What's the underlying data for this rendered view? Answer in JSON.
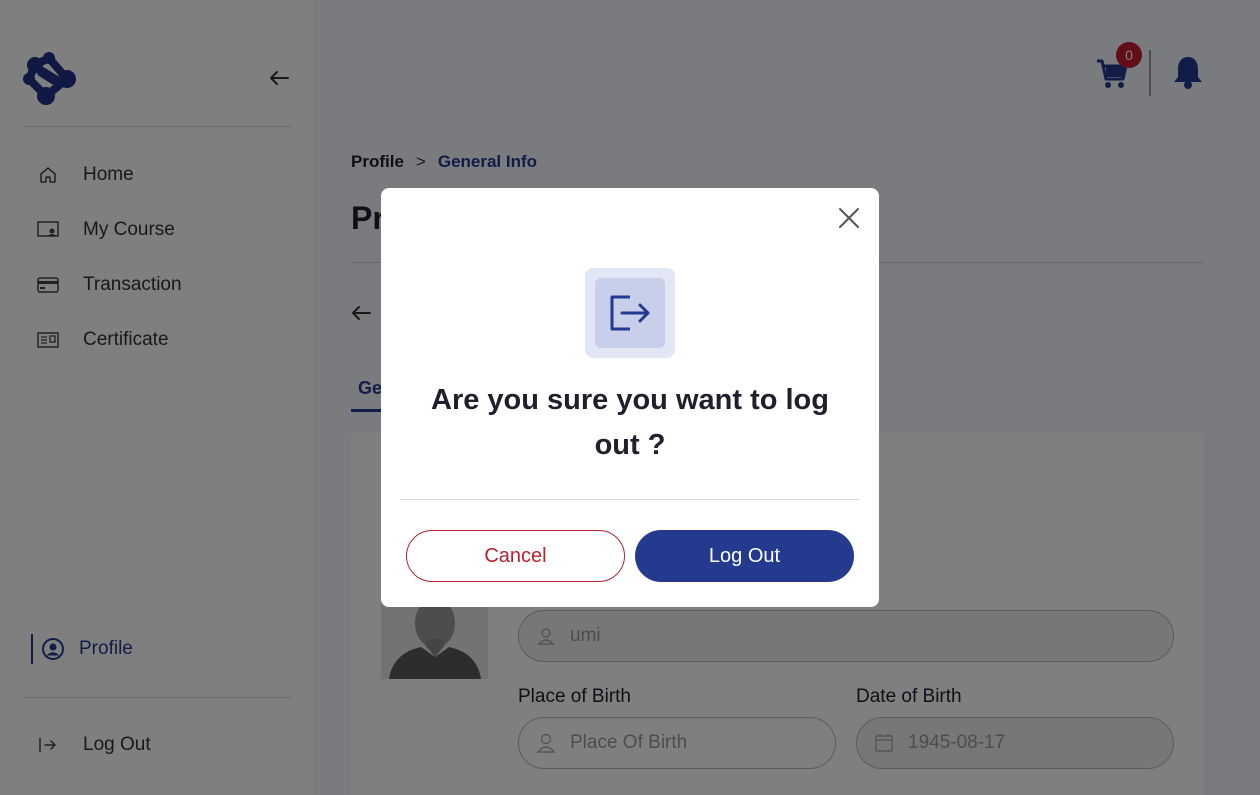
{
  "sidebar": {
    "items": [
      {
        "label": "Home",
        "icon": "home-icon"
      },
      {
        "label": "My Course",
        "icon": "course-icon"
      },
      {
        "label": "Transaction",
        "icon": "card-icon"
      },
      {
        "label": "Certificate",
        "icon": "certificate-icon"
      }
    ],
    "profile_label": "Profile",
    "logout_label": "Log Out"
  },
  "header": {
    "cart_count": "0"
  },
  "breadcrumb": {
    "root": "Profile",
    "separator": ">",
    "current": "General Info"
  },
  "page": {
    "title": "Profile",
    "active_tab": "General Info"
  },
  "form": {
    "name_value": "umi",
    "place_label": "Place of Birth",
    "place_placeholder": "Place Of Birth",
    "dob_label": "Date of Birth",
    "dob_value": "1945-08-17"
  },
  "modal": {
    "question": "Are you sure you want to log out ?",
    "cancel_label": "Cancel",
    "confirm_label": "Log Out"
  },
  "colors": {
    "brand": "#233a8e",
    "danger": "#b8222f",
    "badge": "#c51b2e"
  }
}
